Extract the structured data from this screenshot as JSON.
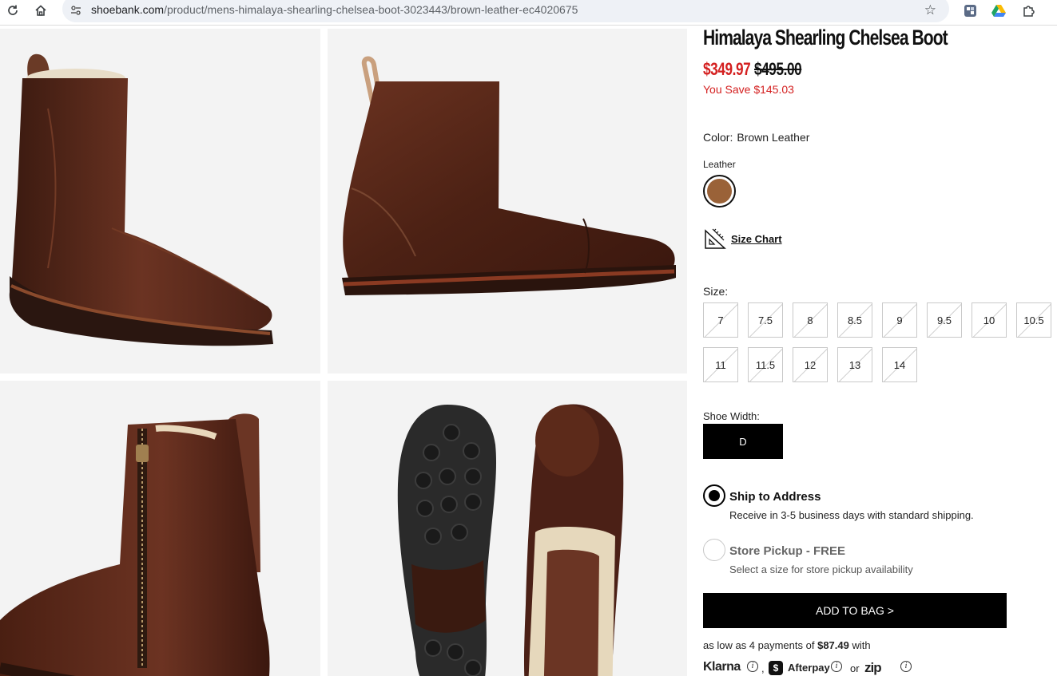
{
  "browser": {
    "url_domain": "shoebank.com",
    "url_path": "/product/mens-himalaya-shearling-chelsea-boot-3023443/brown-leather-ec4020675",
    "icons": [
      "reload-icon",
      "home-icon",
      "site-info-icon",
      "bookmark-star-icon",
      "extension-icon",
      "google-drive-icon",
      "extensions-puzzle-icon"
    ]
  },
  "product": {
    "title": "Himalaya Shearling Chelsea Boot",
    "sale_price": "$349.97",
    "original_price": "$495.00",
    "you_save": "You Save $145.03",
    "color_label": "Color:",
    "color_value": "Brown Leather",
    "material_label": "Leather",
    "swatch_color": "#9a6238",
    "size_chart_label": "Size Chart",
    "size_label": "Size:",
    "sizes": [
      "7",
      "7.5",
      "8",
      "8.5",
      "9",
      "9.5",
      "10",
      "10.5",
      "11",
      "11.5",
      "12",
      "13",
      "14"
    ],
    "width_label": "Shoe Width:",
    "width_value": "D"
  },
  "shipping": {
    "ship_title": "Ship to Address",
    "ship_sub": "Receive in 3-5 business days with standard shipping.",
    "pickup_title": "Store Pickup - FREE",
    "pickup_sub": "Select a size for store pickup availability"
  },
  "cart": {
    "add_to_bag": "ADD TO BAG >",
    "pay_prefix": "as low as 4 payments of",
    "pay_amount": "$87.49",
    "pay_suffix": "with",
    "klarna": "Klarna",
    "afterpay": "Afterpay",
    "afterpay_badge": "$",
    "or": "or",
    "zip": "zip",
    "info": "i",
    "comma": ","
  },
  "colors": {
    "sale_red": "#d42020",
    "leather": "#5a2a1c",
    "button_black": "#000000"
  }
}
